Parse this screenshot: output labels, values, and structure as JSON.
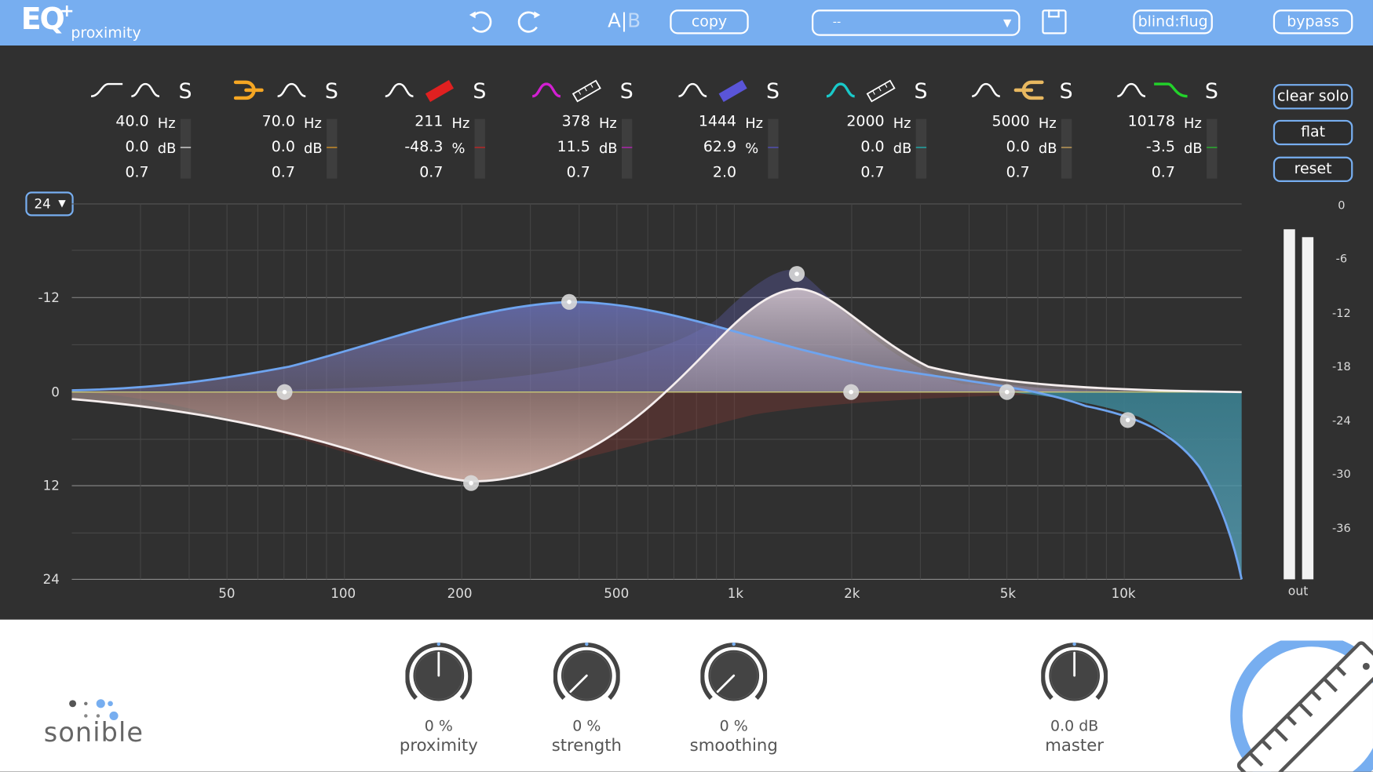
{
  "app": {
    "logo": "EQ",
    "logo_plus": "+",
    "name": "proximity"
  },
  "toolbar": {
    "undo_icon": "undo-icon",
    "redo_icon": "redo-icon",
    "ab_a": "A",
    "ab_sep": "|",
    "ab_b": "B",
    "copy_label": "copy",
    "preset_value": "--",
    "save_icon": "save-icon",
    "blind_label": "blind:flug",
    "bypass_label": "bypass"
  },
  "bands": [
    {
      "freq": "40.0",
      "freq_unit": "Hz",
      "gain": "0.0",
      "gain_unit": "dB",
      "q": "0.7",
      "color": "#ffffff",
      "solo": "S",
      "icon": "high-pass-icon"
    },
    {
      "freq": "70.0",
      "freq_unit": "Hz",
      "gain": "0.0",
      "gain_unit": "dB",
      "q": "0.7",
      "color": "#f5a623",
      "solo": "S",
      "icon": "proximity-low-icon"
    },
    {
      "freq": "211",
      "freq_unit": "Hz",
      "gain": "-48.3",
      "gain_unit": "%",
      "q": "0.7",
      "color": "#e02020",
      "solo": "S",
      "icon": "ruler-icon"
    },
    {
      "freq": "378",
      "freq_unit": "Hz",
      "gain": "11.5",
      "gain_unit": "dB",
      "q": "0.7",
      "color": "#d21fd2",
      "solo": "S",
      "icon": "bell-icon"
    },
    {
      "freq": "1444",
      "freq_unit": "Hz",
      "gain": "62.9",
      "gain_unit": "%",
      "q": "2.0",
      "color": "#5a55d8",
      "solo": "S",
      "icon": "ruler-icon"
    },
    {
      "freq": "2000",
      "freq_unit": "Hz",
      "gain": "0.0",
      "gain_unit": "dB",
      "q": "0.7",
      "color": "#19c9c9",
      "solo": "S",
      "icon": "bell-icon"
    },
    {
      "freq": "5000",
      "freq_unit": "Hz",
      "gain": "0.0",
      "gain_unit": "dB",
      "q": "0.7",
      "color": "#e8b860",
      "solo": "S",
      "icon": "proximity-high-icon"
    },
    {
      "freq": "10178",
      "freq_unit": "Hz",
      "gain": "-3.5",
      "gain_unit": "dB",
      "q": "0.7",
      "color": "#22d22a",
      "solo": "S",
      "icon": "high-shelf-icon"
    }
  ],
  "side_buttons": {
    "clear_solo": "clear solo",
    "flat": "flat",
    "reset": "reset"
  },
  "range": {
    "value": "24",
    "caret": "▼"
  },
  "graph": {
    "y_labels": [
      "-12",
      "0",
      "12",
      "24"
    ],
    "x_labels": [
      "50",
      "100",
      "200",
      "500",
      "1k",
      "2k",
      "5k",
      "10k"
    ]
  },
  "output_meter": {
    "ticks": [
      "0",
      "-6",
      "-12",
      "-18",
      "-24",
      "-30",
      "-36"
    ],
    "label": "out",
    "left_level": 0.93,
    "right_level": 0.91
  },
  "knobs": [
    {
      "value": "0 %",
      "name": "proximity",
      "position": 0.5
    },
    {
      "value": "0 %",
      "name": "strength",
      "position": 0.0
    },
    {
      "value": "0 %",
      "name": "smoothing",
      "position": 0.0
    },
    {
      "value": "0.0 dB",
      "name": "master",
      "position": 0.5
    }
  ],
  "brand": {
    "name": "sonible"
  },
  "colors": {
    "accent": "#77aef0",
    "background": "#303030",
    "curve_blue": "#6ea4ef",
    "curve_white": "#f5f0f0"
  }
}
